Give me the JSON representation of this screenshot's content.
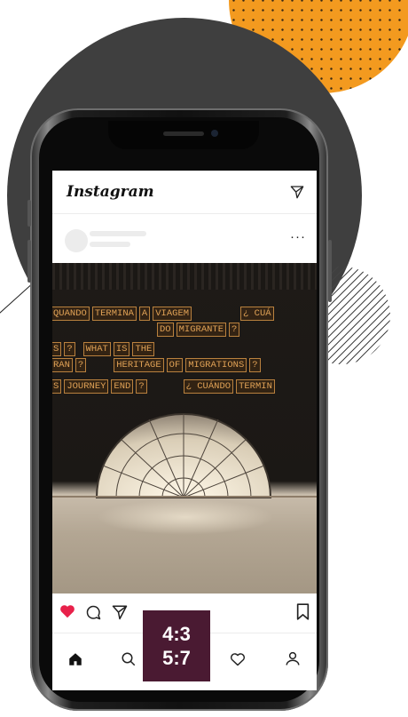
{
  "app": {
    "name": "Instagram"
  },
  "post": {
    "image_lines": [
      [
        "QUANDO",
        "TERMINA",
        "A",
        "VIAGEM",
        "¿ CUÁ"
      ],
      [
        "DO",
        "MIGRANTE",
        "?"
      ],
      [
        "S",
        "?",
        "WHAT",
        "IS",
        "THE"
      ],
      [
        "RAN",
        "?",
        "HERITAGE",
        "OF",
        "MIGRATIONS",
        "?"
      ],
      [
        "S",
        "JOURNEY",
        "END",
        "?",
        "¿ CUÁNDO",
        "TERMIN"
      ]
    ]
  },
  "icons": {
    "send": "paper-plane-icon",
    "more": "more-dots-icon",
    "like": "heart-filled-icon",
    "comment": "comment-bubble-icon",
    "share": "paper-plane-icon",
    "save": "bookmark-icon",
    "home": "home-icon",
    "search": "search-icon",
    "activity": "heart-outline-icon",
    "profile": "profile-icon"
  },
  "more_glyph": "···",
  "badge": {
    "line1": "4:3",
    "line2": "5:7"
  },
  "colors": {
    "like": "#e8214a",
    "badge_bg": "#4a1a32",
    "accent_orange": "#f39a1f",
    "tile_text": "#e0a256"
  }
}
